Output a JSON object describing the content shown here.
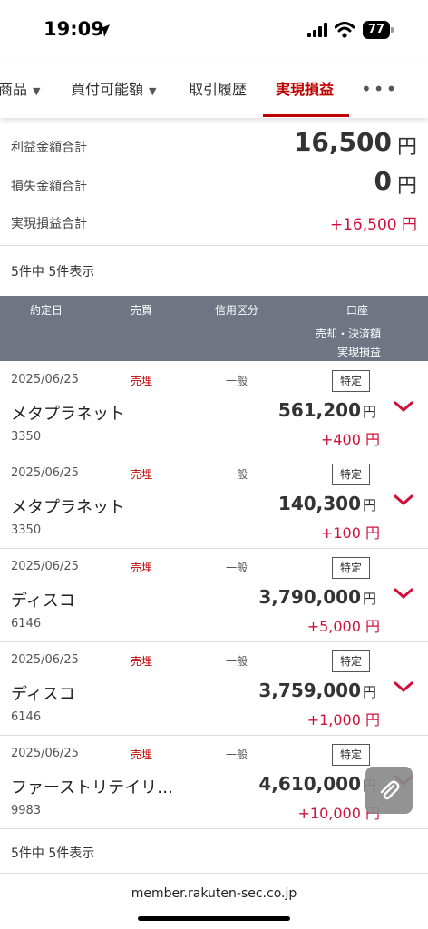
{
  "status": {
    "time": "19:09",
    "battery": "77"
  },
  "tabs": [
    {
      "label": "商品",
      "caret": "▼"
    },
    {
      "label": "買付可能額",
      "caret": "▼"
    },
    {
      "label": "取引履歴",
      "caret": ""
    },
    {
      "label": "実現損益",
      "caret": ""
    }
  ],
  "more_label": "•••",
  "summary": {
    "profit_label": "利益金額合計",
    "profit_value": "16,500",
    "profit_unit": "円",
    "loss_label": "損失金額合計",
    "loss_value": "0",
    "loss_unit": "円",
    "realized_label": "実現損益合計",
    "realized_value": "+16,500 円"
  },
  "count_top": "5件中 5件表示",
  "count_bottom": "5件中 5件表示",
  "table_header": {
    "date": "約定日",
    "trade": "売買",
    "credit": "信用区分",
    "account": "口座",
    "settle": "売却・決済額",
    "pl": "実現損益"
  },
  "rows": [
    {
      "date": "2025/06/25",
      "type": "売埋",
      "kbn": "一般",
      "account": "特定",
      "name": "メタプラネット",
      "code": "3350",
      "amount": "561,200",
      "unit": "円",
      "pl": "+400 円"
    },
    {
      "date": "2025/06/25",
      "type": "売埋",
      "kbn": "一般",
      "account": "特定",
      "name": "メタプラネット",
      "code": "3350",
      "amount": "140,300",
      "unit": "円",
      "pl": "+100 円"
    },
    {
      "date": "2025/06/25",
      "type": "売埋",
      "kbn": "一般",
      "account": "特定",
      "name": "ディスコ",
      "code": "6146",
      "amount": "3,790,000",
      "unit": "円",
      "pl": "+5,000 円"
    },
    {
      "date": "2025/06/25",
      "type": "売埋",
      "kbn": "一般",
      "account": "特定",
      "name": "ディスコ",
      "code": "6146",
      "amount": "3,759,000",
      "unit": "円",
      "pl": "+1,000 円"
    },
    {
      "date": "2025/06/25",
      "type": "売埋",
      "kbn": "一般",
      "account": "特定",
      "name": "ファーストリテイリ…",
      "code": "9983",
      "amount": "4,610,000",
      "unit": "円",
      "pl": "+10,000 円"
    }
  ],
  "url": "member.rakuten-sec.co.jp",
  "colors": {
    "accent": "#bf0000",
    "profit": "#d0103a",
    "header_bg": "#6f7583"
  },
  "icons": [
    "location-arrow-icon",
    "signal-icon",
    "wifi-icon",
    "battery-icon",
    "more-icon",
    "chevron-down-icon",
    "paperclip-icon"
  ]
}
